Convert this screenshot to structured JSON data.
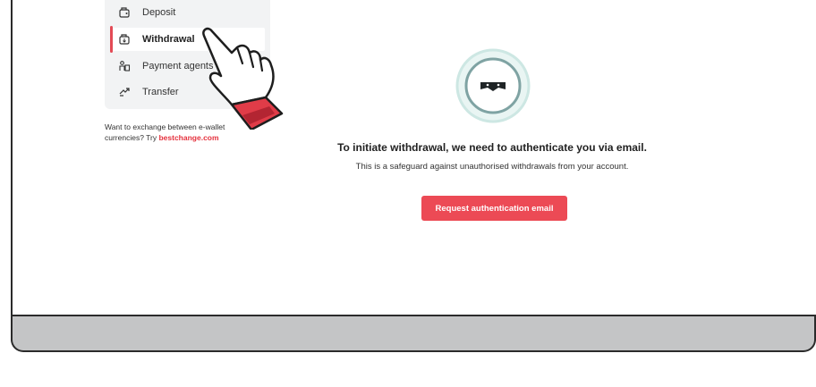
{
  "sidebar": {
    "items": [
      {
        "label": "Deposit",
        "icon": "deposit-icon"
      },
      {
        "label": "Withdrawal",
        "icon": "withdrawal-icon",
        "active": true
      },
      {
        "label": "Payment agents",
        "icon": "payment-agent-icon"
      },
      {
        "label": "Transfer",
        "icon": "transfer-icon"
      }
    ]
  },
  "hint": {
    "text": "Want to exchange between e-wallet currencies? Try ",
    "link": "bestchange.com"
  },
  "main": {
    "title": "To initiate withdrawal, we need to authenticate you via email.",
    "subtitle": "This is a safeguard against unauthorised withdrawals from your account.",
    "button_label": "Request authentication email"
  },
  "colors": {
    "accent": "#ec4a55",
    "icon_ring": "#cde7e3"
  }
}
